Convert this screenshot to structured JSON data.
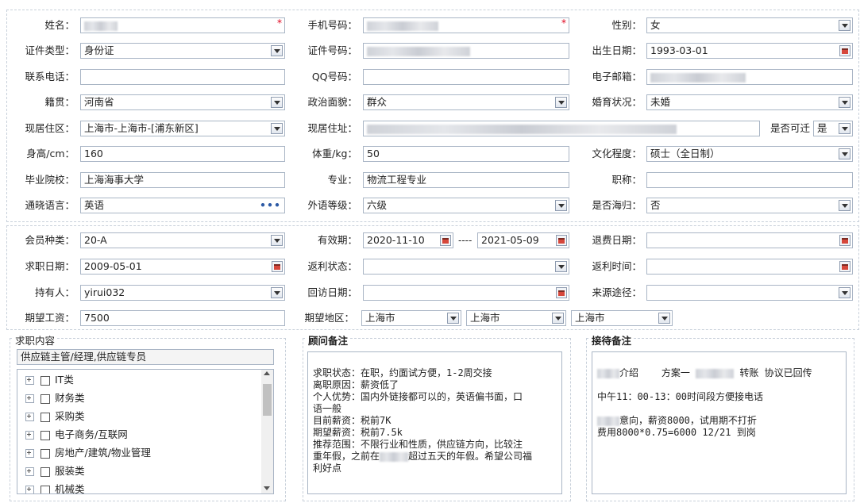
{
  "row1": {
    "name_label": "姓名：",
    "name_value": "",
    "phone_label": "手机号码：",
    "phone_value": "",
    "gender_label": "性别：",
    "gender_value": "女",
    "required_mark": "*"
  },
  "row2": {
    "idtype_label": "证件类型：",
    "idtype_value": "身份证",
    "idno_label": "证件号码：",
    "idno_value": "",
    "birth_label": "出生日期：",
    "birth_value": "1993-03-01"
  },
  "row3": {
    "contact_label": "联系电话：",
    "contact_value": "",
    "qq_label": "QQ号码：",
    "qq_value": "",
    "email_label": "电子邮箱：",
    "email_value": ""
  },
  "row4": {
    "origin_label": "籍贯：",
    "origin_value": "河南省",
    "politics_label": "政治面貌：",
    "politics_value": "群众",
    "marital_label": "婚育状况：",
    "marital_value": "未婚"
  },
  "row5": {
    "residence_label": "现居住区：",
    "residence_value": "上海市-上海市-[浦东新区]",
    "address_label": "现居住址：",
    "address_value": "",
    "relocate_label": "是否可迁",
    "relocate_value": "是"
  },
  "row6": {
    "height_label": "身高/cm：",
    "height_value": "160",
    "weight_label": "体重/kg：",
    "weight_value": "50",
    "education_label": "文化程度：",
    "education_value": "硕士（全日制）"
  },
  "row7": {
    "school_label": "毕业院校：",
    "school_value": "上海海事大学",
    "major_label": "专业：",
    "major_value": "物流工程专业",
    "title_label": "职称：",
    "title_value": ""
  },
  "row8": {
    "language_label": "通晓语言：",
    "language_value": "英语",
    "language_more": "•••",
    "level_label": "外语等级：",
    "level_value": "六级",
    "returnee_label": "是否海归：",
    "returnee_value": "否"
  },
  "row9": {
    "member_label": "会员种类：",
    "member_value": "20-A",
    "validity_label": "有效期：",
    "validity_from": "2020-11-10",
    "validity_sep": "----",
    "validity_to": "2021-05-09",
    "refund_label": "退费日期：",
    "refund_value": ""
  },
  "row10": {
    "jobdate_label": "求职日期：",
    "jobdate_value": "2009-05-01",
    "rebate_status_label": "返利状态：",
    "rebate_status_value": "",
    "rebate_time_label": "返利时间：",
    "rebate_time_value": ""
  },
  "row11": {
    "holder_label": "持有人：",
    "holder_value": "yirui032",
    "visit_label": "回访日期：",
    "visit_value": "",
    "source_label": "来源途径：",
    "source_value": ""
  },
  "row12": {
    "salary_label": "期望工资：",
    "salary_value": "7500",
    "region_label": "期望地区：",
    "region_1": "上海市",
    "region_2": "上海市",
    "region_3": "上海市"
  },
  "job_section": {
    "title": "求职内容",
    "selected": "供应链主管/经理,供应链专员",
    "categories": [
      "IT类",
      "财务类",
      "采购类",
      "电子商务/互联网",
      "房地产/建筑/物业管理",
      "服装类",
      "机械类"
    ]
  },
  "consultant_section": {
    "title": "顾问备注",
    "lines": [
      "求职状态：在职，约面试方便，1-2周交接",
      "离职原因：薪资低了",
      "个人优势：国内外链接都可以的，英语偏书面，口",
      "语一般",
      "目前薪资：税前7K",
      "期望薪资：税前7.5k",
      "推荐范围：不限行业和性质，供应链方向，比较注",
      "重年假，之前在",
      "超过五天的年假。希望公司福",
      "利好点"
    ]
  },
  "reception_section": {
    "title": "接待备注",
    "lines": [
      "介绍",
      "方案一",
      "转账 协议已回传",
      "中午11：00-13：00时间段方便接电话",
      "意向，薪资8000，试用期不打折",
      "费用8000*0.75=6000 12/21 到岗"
    ]
  }
}
